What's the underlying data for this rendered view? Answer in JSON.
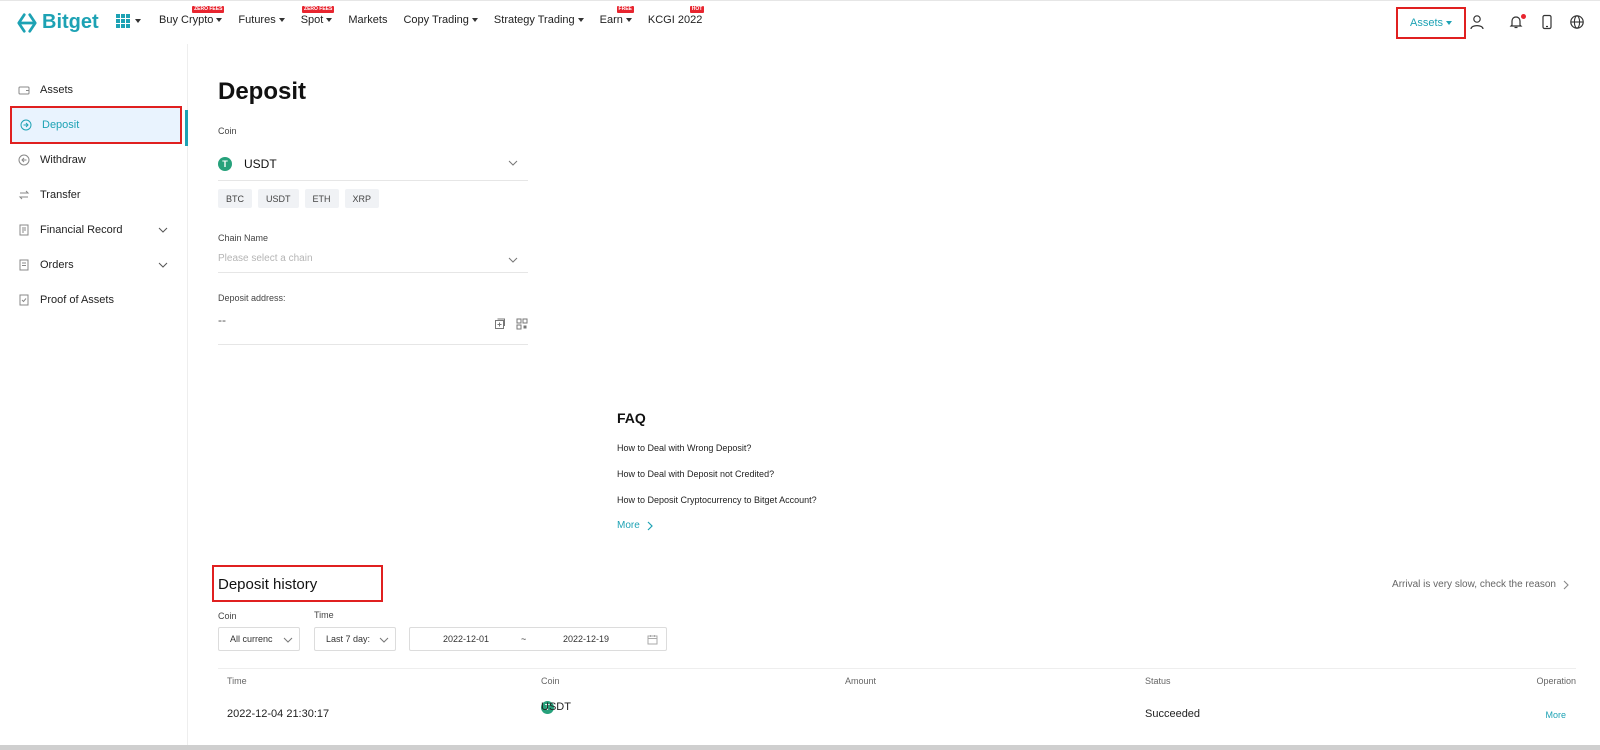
{
  "brand": {
    "name": "Bitget",
    "accent": "#1da2b4",
    "alert": "#e02020"
  },
  "nav": {
    "items": [
      {
        "label": "Buy Crypto",
        "badge": "ZERO FEES",
        "has_caret": true
      },
      {
        "label": "Futures",
        "badge": "",
        "has_caret": true
      },
      {
        "label": "Spot",
        "badge": "ZERO FEES",
        "has_caret": true
      },
      {
        "label": "Markets",
        "badge": "",
        "has_caret": false
      },
      {
        "label": "Copy Trading",
        "badge": "",
        "has_caret": true
      },
      {
        "label": "Strategy Trading",
        "badge": "",
        "has_caret": true
      },
      {
        "label": "Earn",
        "badge": "FREE",
        "has_caret": true
      },
      {
        "label": "KCGI 2022",
        "badge": "HOT",
        "has_caret": false
      }
    ],
    "assets_label": "Assets",
    "icons": [
      "user-icon",
      "bell-icon",
      "phone-icon",
      "globe-icon"
    ]
  },
  "sidebar": {
    "items": [
      {
        "label": "Assets",
        "icon": "wallet-icon"
      },
      {
        "label": "Deposit",
        "icon": "deposit-icon",
        "active": true
      },
      {
        "label": "Withdraw",
        "icon": "withdraw-icon"
      },
      {
        "label": "Transfer",
        "icon": "transfer-icon"
      },
      {
        "label": "Financial Record",
        "icon": "record-icon",
        "expandable": true
      },
      {
        "label": "Orders",
        "icon": "orders-icon",
        "expandable": true
      },
      {
        "label": "Proof of Assets",
        "icon": "proof-icon"
      }
    ]
  },
  "deposit": {
    "title": "Deposit",
    "coin_label": "Coin",
    "coin_value": "USDT",
    "quick_coins": [
      "BTC",
      "USDT",
      "ETH",
      "XRP"
    ],
    "chain_label": "Chain Name",
    "chain_placeholder": "Please select a chain",
    "address_label": "Deposit address:",
    "address_value": "--"
  },
  "faq": {
    "title": "FAQ",
    "links": [
      "How to Deal with Wrong Deposit?",
      "How to Deal with Deposit not Credited?",
      "How to Deposit Cryptocurrency to Bitget Account?"
    ],
    "more_label": "More"
  },
  "history": {
    "title": "Deposit history",
    "slow_link": "Arrival is very slow, check the reason",
    "coin_filter_label": "Coin",
    "coin_filter_value": "All currenc",
    "time_filter_label": "Time",
    "time_filter_value": "Last 7 day:",
    "date_from": "2022-12-01",
    "date_sep": "~",
    "date_to": "2022-12-19",
    "columns": [
      "Time",
      "Coin",
      "Amount",
      "Status",
      "Operation"
    ],
    "rows": [
      {
        "time": "2022-12-04 21:30:17",
        "coin": "USDT",
        "amount": "",
        "status": "Succeeded",
        "operation": "More"
      }
    ]
  }
}
